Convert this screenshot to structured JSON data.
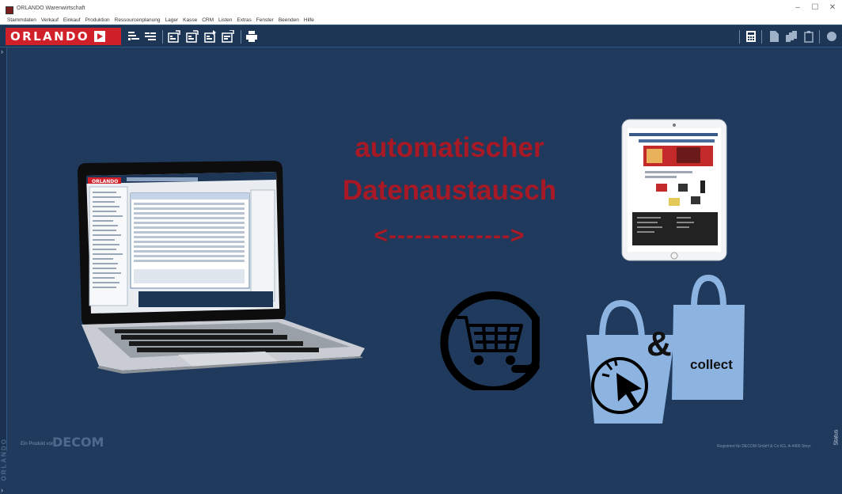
{
  "window": {
    "title": "ORLANDO Warenwirtschaft",
    "minimize_glyph": "–",
    "maximize_glyph": "☐",
    "close_glyph": "✕"
  },
  "menu": {
    "items": [
      "Stammdaten",
      "Verkauf",
      "Einkauf",
      "Produktion",
      "Ressourcenplanung",
      "Lager",
      "Kasse",
      "CRM",
      "Listen",
      "Extras",
      "Fenster",
      "Beenden",
      "Hilfe"
    ]
  },
  "toolbar": {
    "logo_text": "ORLANDO",
    "left_icons": [
      "list-add-icon",
      "list-up-icon",
      "doc-import-icon",
      "doc-export-icon",
      "doc-sync-icon",
      "doc-transfer-icon",
      "print-icon"
    ],
    "right_icons": [
      "calculator-icon",
      "document-icon",
      "multi-document-icon",
      "clipboard-icon",
      "globe-icon"
    ]
  },
  "sidebar": {
    "brand": "ORLANDO"
  },
  "main": {
    "headline_line1": "automatischer",
    "headline_line2": "Datenaustausch",
    "arrow": "<-------------->",
    "collect_amp": "&",
    "collect_label": "collect",
    "laptop_logo": "ORLANDO"
  },
  "footer": {
    "left_text": "Ein Produkt von",
    "decom": "DECOM",
    "right_text": "Registriert für DECOM GmbH & Co KG, A-4400 Steyr",
    "status": "Status"
  },
  "colors": {
    "background": "#1f3a5c",
    "accent_red": "#a81825",
    "logo_red": "#d0202a",
    "bag_blue": "#8db4e0"
  }
}
